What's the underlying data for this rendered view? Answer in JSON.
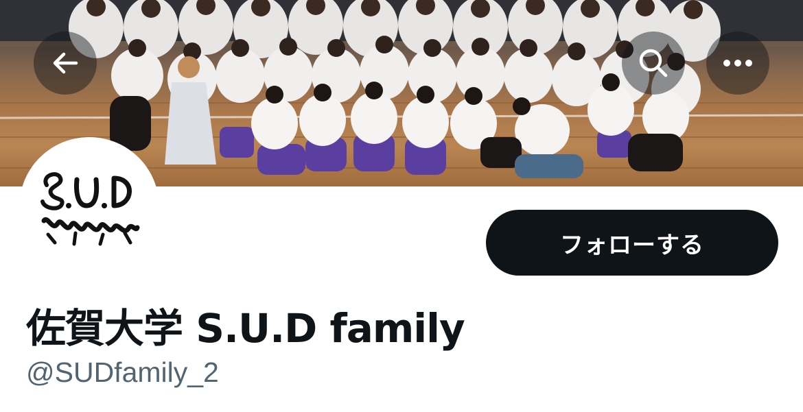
{
  "header": {
    "back_icon": "arrow-left-icon",
    "search_icon": "search-icon",
    "more_icon": "more-horizontal-icon"
  },
  "banner": {
    "description_icon": "group-photo-banner"
  },
  "profile": {
    "display_name": "佐賀大学 S.U.D family",
    "handle": "@SUDfamily_2",
    "avatar_logo": "S.U.D family"
  },
  "actions": {
    "follow_label": "フォローする"
  },
  "colors": {
    "primary_text": "#0f1419",
    "secondary_text": "#536471",
    "button_bg": "#0f1419",
    "button_text": "#ffffff"
  }
}
